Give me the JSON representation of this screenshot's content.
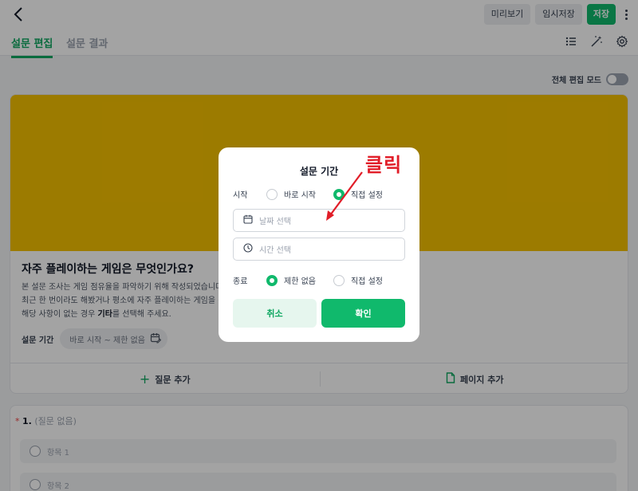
{
  "header": {
    "preview_label": "미리보기",
    "temp_save_label": "임시저장",
    "save_label": "저장"
  },
  "tabs": {
    "edit_label": "설문 편집",
    "results_label": "설문 결과"
  },
  "toolbar": {
    "bulk_edit_label": "전체 편집 모드"
  },
  "survey": {
    "title": "자주 플레이하는 게임은 무엇인가요?",
    "desc_line1": "본 설문 조사는 게임 점유율을 파악하기 위해 작성되었습니다.",
    "desc_line2": "최근 한 번이라도 해봤거나 평소에 자주 플레이하는 게임을 선",
    "desc_line3_pre": "해당 사항이 없는 경우 ",
    "desc_line3_bold": "기타",
    "desc_line3_post": "를 선택해 주세요.",
    "period_label": "설문 기간",
    "period_value": "바로 시작 ~ 제한 없음",
    "add_question_label": "질문 추가",
    "add_page_label": "페이지 추가"
  },
  "question": {
    "star": "*",
    "number": "1.",
    "title": "(질문 없음)",
    "options": [
      "항목 1",
      "항목 2"
    ]
  },
  "modal": {
    "title": "설문 기간",
    "start_label": "시작",
    "start_options": [
      "바로 시작",
      "직접 설정"
    ],
    "date_placeholder": "날짜 선택",
    "time_placeholder": "시간 선택",
    "end_label": "종료",
    "end_options": [
      "제한 없음",
      "직접 설정"
    ],
    "cancel_label": "취소",
    "confirm_label": "확인"
  },
  "annotation": {
    "text": "클릭",
    "color": "#e11d28"
  },
  "colors": {
    "accent": "#10b96c",
    "cover": "#f5c000"
  }
}
